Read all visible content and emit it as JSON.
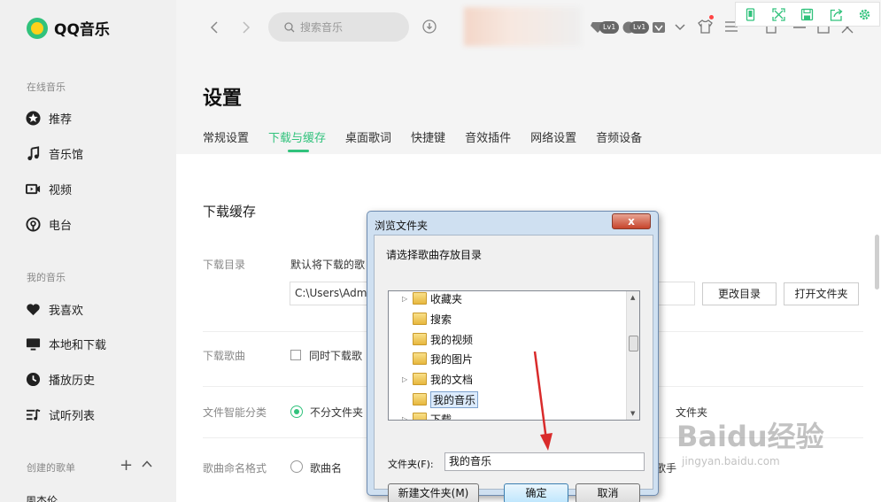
{
  "app": {
    "name": "QQ音乐"
  },
  "sidebar": {
    "online_title": "在线音乐",
    "online_items": [
      {
        "label": "推荐",
        "icon": "star-icon"
      },
      {
        "label": "音乐馆",
        "icon": "music-note-icon"
      },
      {
        "label": "视频",
        "icon": "video-icon"
      },
      {
        "label": "电台",
        "icon": "radio-icon"
      }
    ],
    "my_title": "我的音乐",
    "my_items": [
      {
        "label": "我喜欢",
        "icon": "heart-icon"
      },
      {
        "label": "本地和下载",
        "icon": "monitor-icon"
      },
      {
        "label": "播放历史",
        "icon": "history-icon"
      },
      {
        "label": "试听列表",
        "icon": "playlist-icon"
      }
    ],
    "created_title": "创建的歌单",
    "created_items": [
      "周杰伦"
    ]
  },
  "topbar": {
    "search_placeholder": "搜索音乐",
    "badges": [
      "Lv1",
      "Lv1"
    ]
  },
  "settings": {
    "title": "设置",
    "tabs": [
      "常规设置",
      "下载与缓存",
      "桌面歌词",
      "快捷键",
      "音效插件",
      "网络设置",
      "音频设备"
    ],
    "active_tab": "下载与缓存",
    "section_title": "下载缓存",
    "download_dir": {
      "label": "下载目录",
      "desc": "默认将下载的歌",
      "path": "C:\\Users\\Admi",
      "change_button": "更改目录",
      "open_button": "打开文件夹"
    },
    "download_songs": {
      "label": "下载歌曲",
      "checkbox_label": "同时下载歌"
    },
    "smart_classify": {
      "label": "文件智能分类",
      "option1": "不分文件夹",
      "option2_tail": "文件夹"
    },
    "naming": {
      "label": "歌曲命名格式",
      "option1": "歌曲名",
      "option2_tail": "歌手"
    }
  },
  "dialog": {
    "title": "浏览文件夹",
    "close": "x",
    "prompt": "请选择歌曲存放目录",
    "tree": [
      {
        "label": "收藏夹",
        "expander": "▷"
      },
      {
        "label": "搜索",
        "expander": ""
      },
      {
        "label": "我的视频",
        "expander": ""
      },
      {
        "label": "我的图片",
        "expander": ""
      },
      {
        "label": "我的文档",
        "expander": "▷"
      },
      {
        "label": "我的音乐",
        "expander": "",
        "selected": true
      },
      {
        "label": "下载",
        "expander": "▷"
      }
    ],
    "folder_label": "文件夹(F):",
    "folder_value": "我的音乐",
    "new_folder_button": "新建文件夹(M)",
    "ok_button": "确定",
    "cancel_button": "取消"
  },
  "watermark": {
    "main": "Baidu经验",
    "sub": "jingyan.baidu.com"
  },
  "colors": {
    "accent": "#31c27c",
    "arrow": "#d92b2b"
  }
}
